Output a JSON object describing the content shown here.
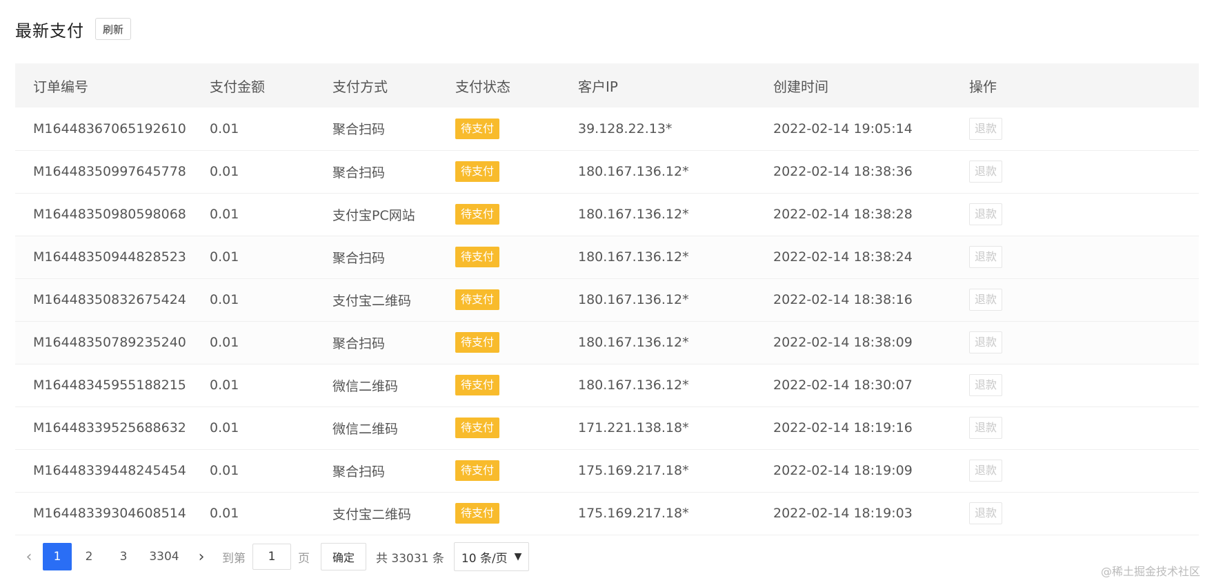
{
  "header": {
    "title": "最新支付",
    "refresh_label": "刷新"
  },
  "table": {
    "columns": [
      "订单编号",
      "支付金额",
      "支付方式",
      "支付状态",
      "客户IP",
      "创建时间",
      "操作"
    ],
    "rows": [
      {
        "order_no": "M16448367065192610",
        "amount": "0.01",
        "method": "聚合扫码",
        "status": "待支付",
        "ip": "39.128.22.13*",
        "created": "2022-02-14 19:05:14",
        "action": "退款"
      },
      {
        "order_no": "M16448350997645778",
        "amount": "0.01",
        "method": "聚合扫码",
        "status": "待支付",
        "ip": "180.167.136.12*",
        "created": "2022-02-14 18:38:36",
        "action": "退款"
      },
      {
        "order_no": "M16448350980598068",
        "amount": "0.01",
        "method": "支付宝PC网站",
        "status": "待支付",
        "ip": "180.167.136.12*",
        "created": "2022-02-14 18:38:28",
        "action": "退款"
      },
      {
        "order_no": "M16448350944828523",
        "amount": "0.01",
        "method": "聚合扫码",
        "status": "待支付",
        "ip": "180.167.136.12*",
        "created": "2022-02-14 18:38:24",
        "action": "退款"
      },
      {
        "order_no": "M16448350832675424",
        "amount": "0.01",
        "method": "支付宝二维码",
        "status": "待支付",
        "ip": "180.167.136.12*",
        "created": "2022-02-14 18:38:16",
        "action": "退款"
      },
      {
        "order_no": "M16448350789235240",
        "amount": "0.01",
        "method": "聚合扫码",
        "status": "待支付",
        "ip": "180.167.136.12*",
        "created": "2022-02-14 18:38:09",
        "action": "退款"
      },
      {
        "order_no": "M16448345955188215",
        "amount": "0.01",
        "method": "微信二维码",
        "status": "待支付",
        "ip": "180.167.136.12*",
        "created": "2022-02-14 18:30:07",
        "action": "退款"
      },
      {
        "order_no": "M16448339525688632",
        "amount": "0.01",
        "method": "微信二维码",
        "status": "待支付",
        "ip": "171.221.138.18*",
        "created": "2022-02-14 18:19:16",
        "action": "退款"
      },
      {
        "order_no": "M16448339448245454",
        "amount": "0.01",
        "method": "聚合扫码",
        "status": "待支付",
        "ip": "175.169.217.18*",
        "created": "2022-02-14 18:19:09",
        "action": "退款"
      },
      {
        "order_no": "M16448339304608514",
        "amount": "0.01",
        "method": "支付宝二维码",
        "status": "待支付",
        "ip": "175.169.217.18*",
        "created": "2022-02-14 18:19:03",
        "action": "退款"
      }
    ]
  },
  "pagination": {
    "prev_icon": "chevron-left-icon",
    "next_icon": "chevron-right-icon",
    "pages": [
      "1",
      "2",
      "3",
      "3304"
    ],
    "active_page": "1",
    "goto_label": "到第",
    "goto_value": "1",
    "page_unit": "页",
    "confirm_label": "确定",
    "total_label": "共 33031 条",
    "page_size": "10 条/页"
  },
  "watermark": "@稀土掘金技术社区",
  "colors": {
    "status_badge": "#f8bb2c",
    "active_page": "#2a6ef5",
    "header_bg": "#f5f5f5"
  }
}
